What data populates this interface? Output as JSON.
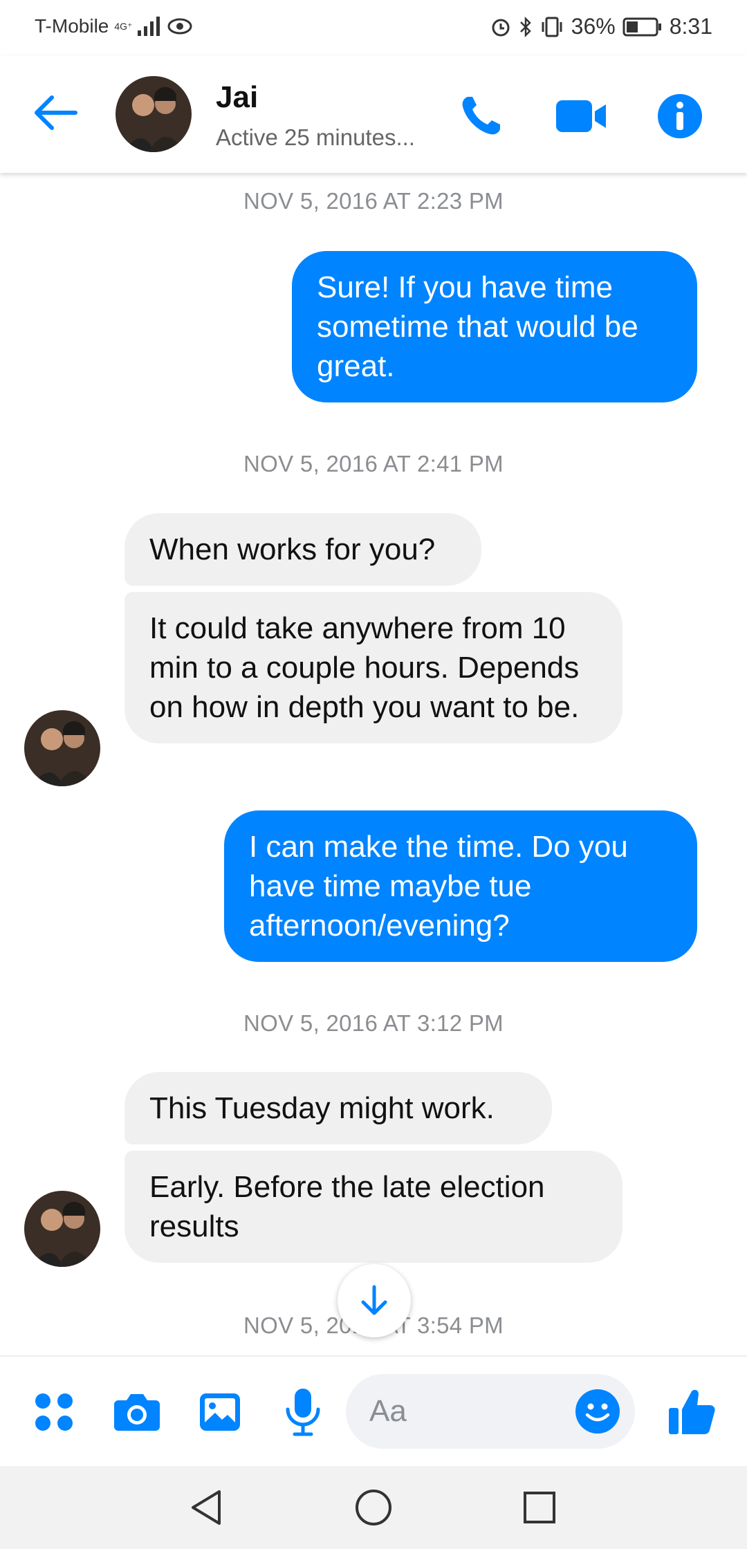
{
  "status_bar": {
    "carrier": "T-Mobile",
    "network": "4G⁺",
    "battery": "36%",
    "time": "8:31"
  },
  "header": {
    "contact_name": "Jai",
    "contact_status": "Active 25 minutes..."
  },
  "messages": [
    {
      "timestamp": "NOV 5, 2016 AT 2:23 PM"
    },
    {
      "out_1": "Sure! If you have time sometime that would be great."
    },
    {
      "timestamp": "NOV 5, 2016 AT 2:41 PM"
    }
  ],
  "chat": {
    "ts_1": "NOV 5, 2016 AT 2:23 PM",
    "out_1": "Sure! If you have time sometime that would be great.",
    "ts_2": "NOV 5, 2016 AT 2:41 PM",
    "in_1": "When works for you?",
    "in_2": "It could take anywhere from 10 min to a couple hours. Depends on how in depth you want to be.",
    "out_2": "I can make the time. Do you have time maybe tue afternoon/evening?",
    "ts_3": "NOV 5, 2016 AT 3:12 PM",
    "in_3": "This Tuesday might work.",
    "in_4": "Early. Before the late election results",
    "ts_4": "NOV 5, 2016 AT 3:54 PM"
  },
  "composer": {
    "placeholder": "Aa"
  },
  "colors": {
    "accent": "#0084ff",
    "incoming_bubble": "#f0f0f0"
  }
}
